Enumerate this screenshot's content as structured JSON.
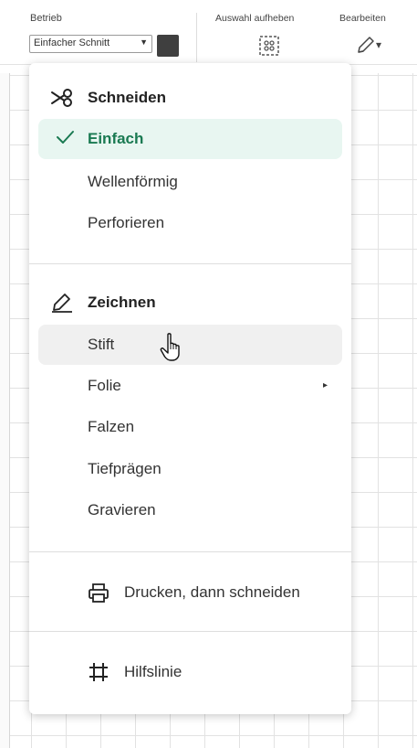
{
  "toolbar": {
    "operation_label": "Betrieb",
    "operation_value": "Einfacher Schnitt",
    "operation_arrow": "▼",
    "deselect_label": "Auswahl aufheben",
    "edit_label": "Bearbeiten",
    "edit_arrow": "▾"
  },
  "menu": {
    "cut_section": {
      "label": "Schneiden",
      "icon": "scissors-icon"
    },
    "cut_items": [
      {
        "label": "Einfach",
        "selected": true
      },
      {
        "label": "Wellenförmig"
      },
      {
        "label": "Perforieren"
      }
    ],
    "draw_section": {
      "label": "Zeichnen",
      "icon": "pen-icon"
    },
    "draw_items": [
      {
        "label": "Stift",
        "hovered": true
      },
      {
        "label": "Folie",
        "has_submenu": true,
        "submenu_arrow": "▸"
      },
      {
        "label": "Falzen"
      },
      {
        "label": "Tiefprägen"
      },
      {
        "label": "Gravieren"
      }
    ],
    "print_then_cut": {
      "label": "Drucken, dann schneiden",
      "icon": "printer-icon"
    },
    "guide": {
      "label": "Hilfslinie",
      "icon": "hash-icon"
    }
  },
  "colors": {
    "accent": "#1a7a52",
    "selected_bg": "#e8f6f1",
    "hover_bg": "#f0f0f0",
    "swatch": "#3f3f3f"
  }
}
